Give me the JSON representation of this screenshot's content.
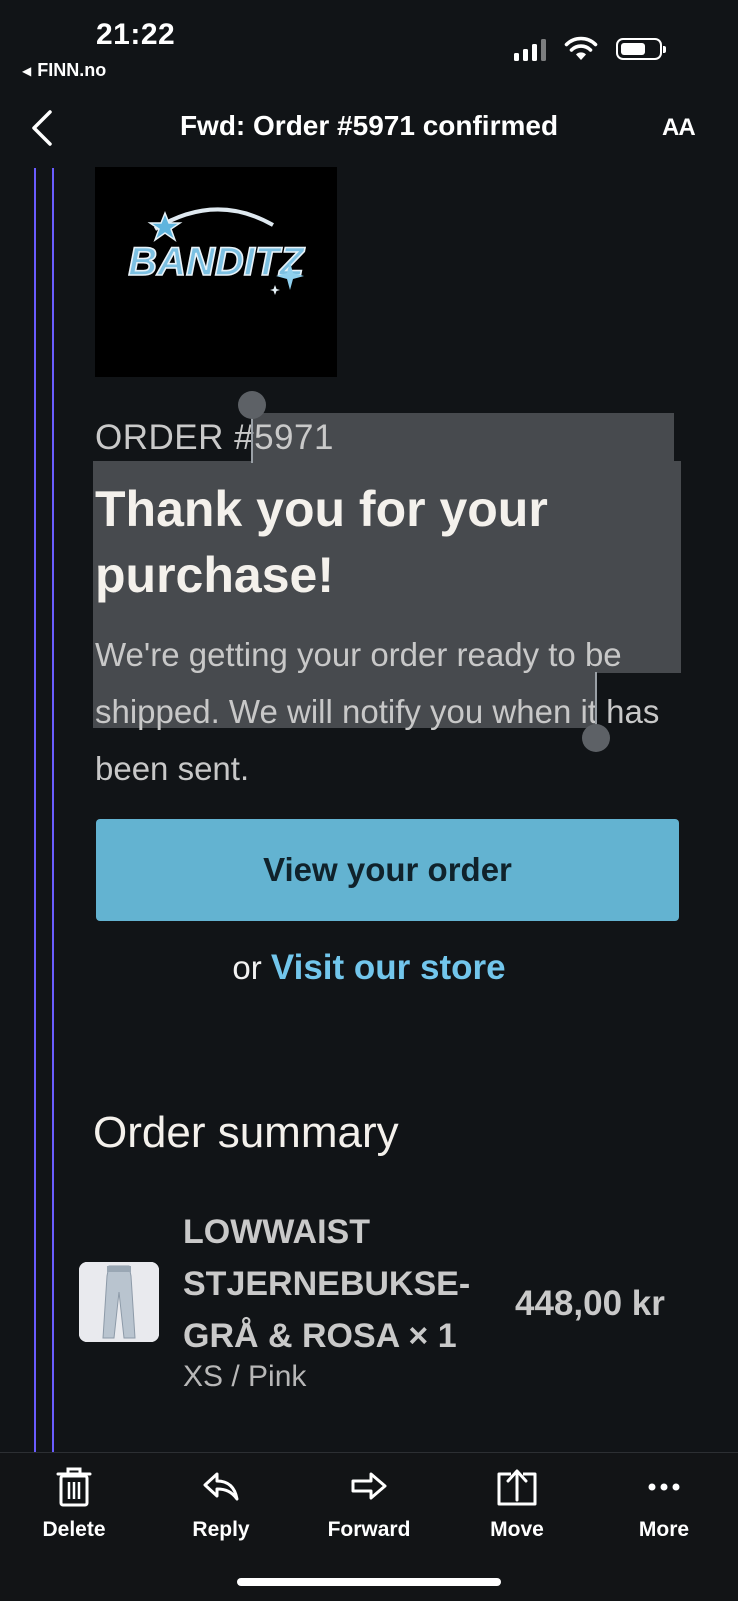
{
  "status_bar": {
    "time": "21:22",
    "back_app": "FINN.no"
  },
  "nav": {
    "title": "Fwd: Order #5971 confirmed",
    "text_size_label": "AA"
  },
  "email": {
    "brand_logo_text": "BANDITZ",
    "order_number": "ORDER #5971",
    "heading": "Thank you for your purchase!",
    "body": "We're getting your order ready to be shipped. We will notify you when it has been sent.",
    "view_order_button": "View your order",
    "or_text": "or",
    "visit_store_link": "Visit our store",
    "summary_title": "Order summary",
    "items": [
      {
        "name": "LOWWAIST STJERNEBUKSE-GRÅ & ROSA × 1",
        "variant": "XS / Pink",
        "price": "448,00 kr"
      }
    ]
  },
  "toolbar": {
    "delete": "Delete",
    "reply": "Reply",
    "forward": "Forward",
    "move": "Move",
    "more": "More"
  },
  "colors": {
    "button": "#63b3d1",
    "link": "#72c6ec",
    "quote_line": "#6a5cff",
    "background": "#111417"
  }
}
